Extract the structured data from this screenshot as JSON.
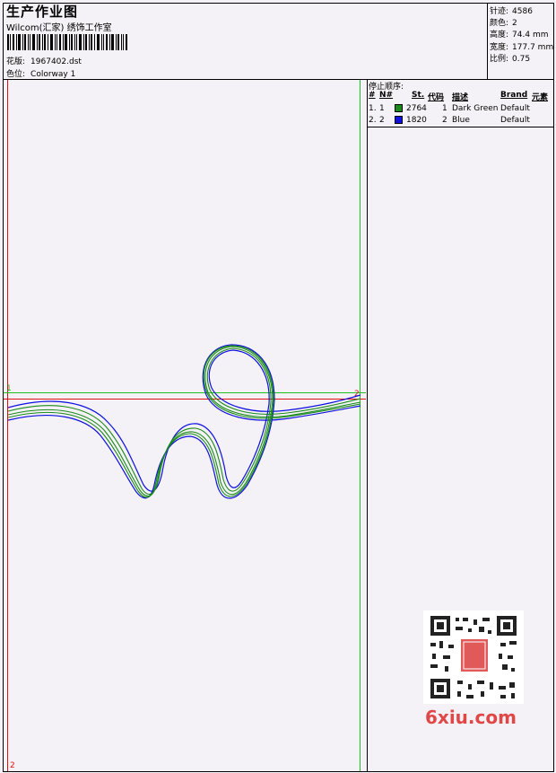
{
  "header": {
    "title": "生产作业图",
    "subtitle": "Wilcom(汇家) 绣饰工作室",
    "design_label": "花版:",
    "design_value": "1967402.dst",
    "colorway_label": "色位:",
    "colorway_value": "Colorway 1"
  },
  "stats": [
    {
      "label": "针迹:",
      "value": "4586"
    },
    {
      "label": "颜色:",
      "value": "2"
    },
    {
      "label": "高度:",
      "value": "74.4 mm"
    },
    {
      "label": "宽度:",
      "value": "177.7 mm"
    },
    {
      "label": "比例:",
      "value": "0.75"
    }
  ],
  "stop_sequence": {
    "title": "停止顺序:",
    "headers": [
      "#",
      "N#",
      "St.",
      "代码",
      "描述",
      "Brand",
      "元素"
    ],
    "rows": [
      {
        "idx": "1.",
        "n": "1",
        "stitches": "2764",
        "code": "1",
        "desc": "Dark Green",
        "brand": "Default",
        "color": "#1a8a1a"
      },
      {
        "idx": "2.",
        "n": "2",
        "stitches": "1820",
        "code": "2",
        "desc": "Blue",
        "brand": "Default",
        "color": "#1010e0"
      }
    ]
  },
  "markers": {
    "start": "1",
    "end": "2",
    "bottom": "2"
  },
  "watermark": {
    "text": "6xiu.com",
    "stamp": "设计图库"
  },
  "colors": {
    "green": "#1a8a1a",
    "blue": "#1010e0",
    "red_guide": "#e01010",
    "green_guide": "#20c020"
  }
}
